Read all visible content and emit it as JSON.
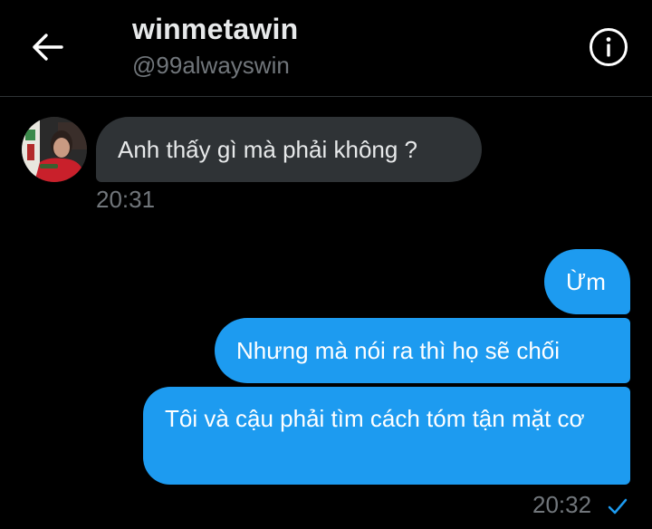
{
  "header": {
    "name": "winmetawin",
    "handle": "@99alwayswin",
    "back_icon": "arrow-left-icon",
    "info_icon": "info-icon"
  },
  "conversation": {
    "incoming": [
      {
        "text": "Anh thấy gì mà phải không ?",
        "time": "20:31"
      }
    ],
    "outgoing": [
      {
        "text": "Ừm"
      },
      {
        "text": "Nhưng mà nói ra thì họ sẽ chối"
      },
      {
        "text": "Tôi và cậu phải tìm cách tóm tận mặt cơ"
      }
    ],
    "outgoing_time": "20:32",
    "read_icon": "checkmark-icon"
  },
  "colors": {
    "background": "#000000",
    "incoming_bubble": "#2f3336",
    "outgoing_bubble": "#1d9bf0",
    "secondary_text": "#71767b",
    "primary_text": "#e7e9ea"
  }
}
